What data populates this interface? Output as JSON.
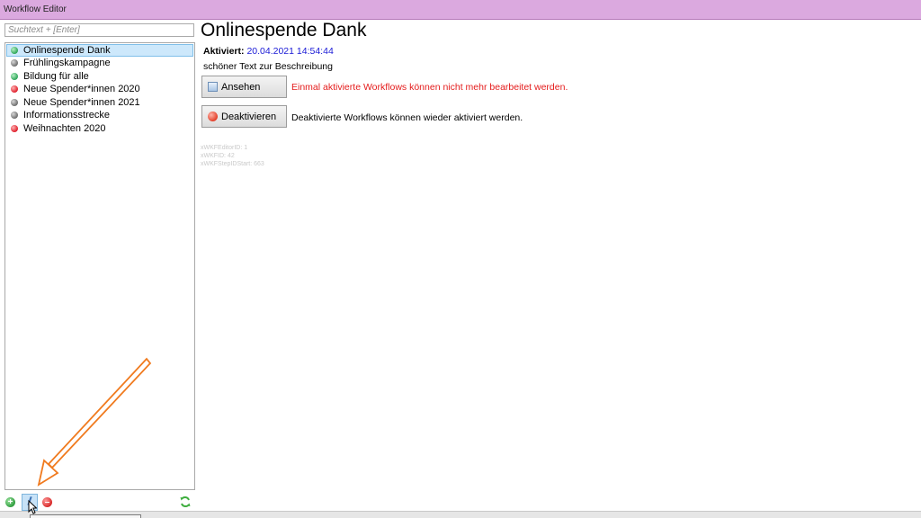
{
  "window": {
    "title": "Workflow Editor"
  },
  "search": {
    "placeholder": "Suchtext + [Enter]"
  },
  "workflows": [
    {
      "label": "Onlinespende Dank",
      "status": "green",
      "selected": true
    },
    {
      "label": "Frühlingskampagne",
      "status": "gray"
    },
    {
      "label": "Bildung für alle",
      "status": "green"
    },
    {
      "label": "Neue Spender*innen 2020",
      "status": "red"
    },
    {
      "label": "Neue Spender*innen 2021",
      "status": "gray"
    },
    {
      "label": "Informationsstrecke",
      "status": "gray"
    },
    {
      "label": "Weihnachten 2020",
      "status": "red"
    }
  ],
  "detail": {
    "title": "Onlinespende Dank",
    "activated_label": "Aktiviert:",
    "activated_value": "20.04.2021 14:54:44",
    "description": "schöner Text zur Beschreibung",
    "view_button": "Ansehen",
    "view_message": "Einmal aktivierte Workflows können nicht mehr bearbeitet werden.",
    "deactivate_button": "Deaktivieren",
    "deactivate_message": "Deaktivierte Workflows können wieder aktiviert werden.",
    "meta": [
      "xWKFEditorID: 1",
      "xWKFID: 42",
      "xWKFStepIDStart: 663"
    ]
  },
  "toolbar": {
    "add_icon": "plus-icon",
    "edit_icon": "pencil-icon",
    "remove_icon": "minus-icon",
    "refresh_icon": "refresh-icon"
  },
  "colors": {
    "titlebar": "#dba9df",
    "selection": "#cde8fb",
    "timestamp": "#1a1ad6",
    "warning": "#e41b1b",
    "annotation_arrow": "#f07a1e"
  }
}
